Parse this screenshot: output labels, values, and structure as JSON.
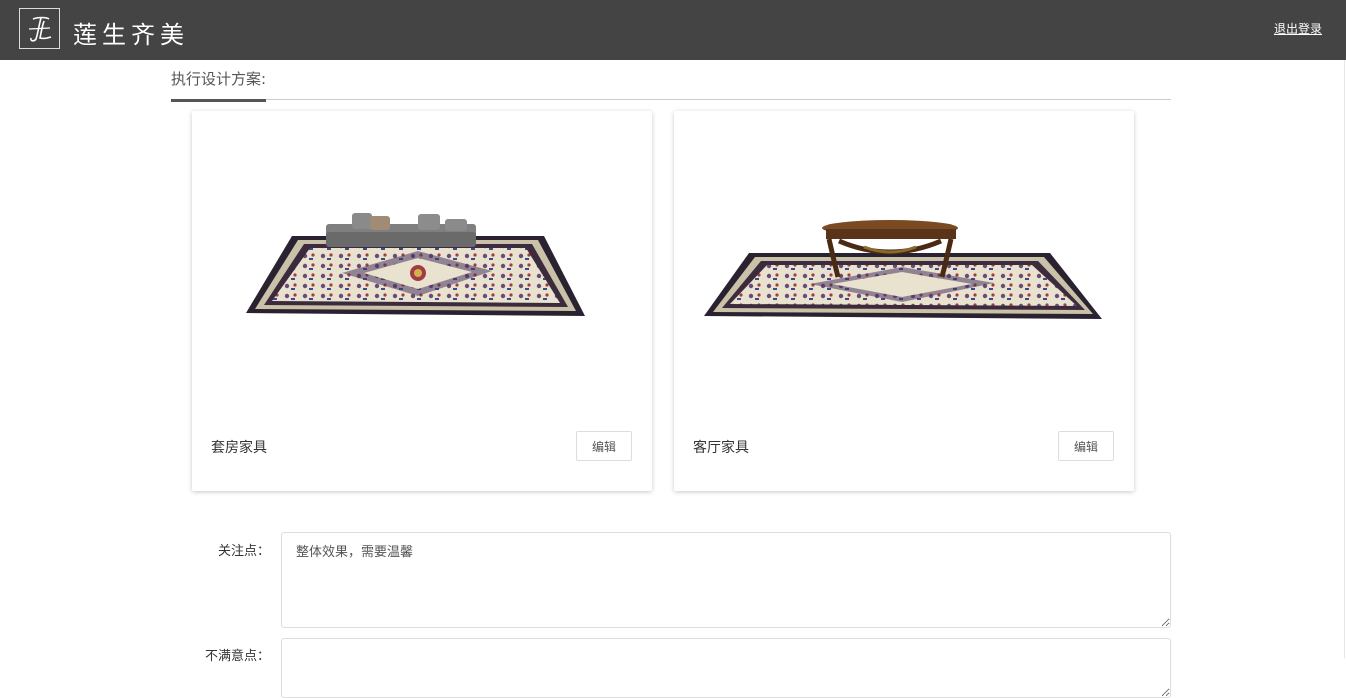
{
  "header": {
    "logo_icon": "jl-monogram-logo",
    "logo_text": "莲生齐美",
    "logout_label": "退出登录"
  },
  "section": {
    "tab_label": "执行设计方案:"
  },
  "cards": [
    {
      "title": "套房家具",
      "edit_label": "编辑",
      "image": "rug-with-gray-sofa"
    },
    {
      "title": "客厅家具",
      "edit_label": "编辑",
      "image": "rug-with-carved-table"
    }
  ],
  "form": {
    "focus_label": "关注点：",
    "focus_value": "整体效果，需要温馨",
    "dissatisfied_label": "不满意点：",
    "dissatisfied_value": ""
  }
}
